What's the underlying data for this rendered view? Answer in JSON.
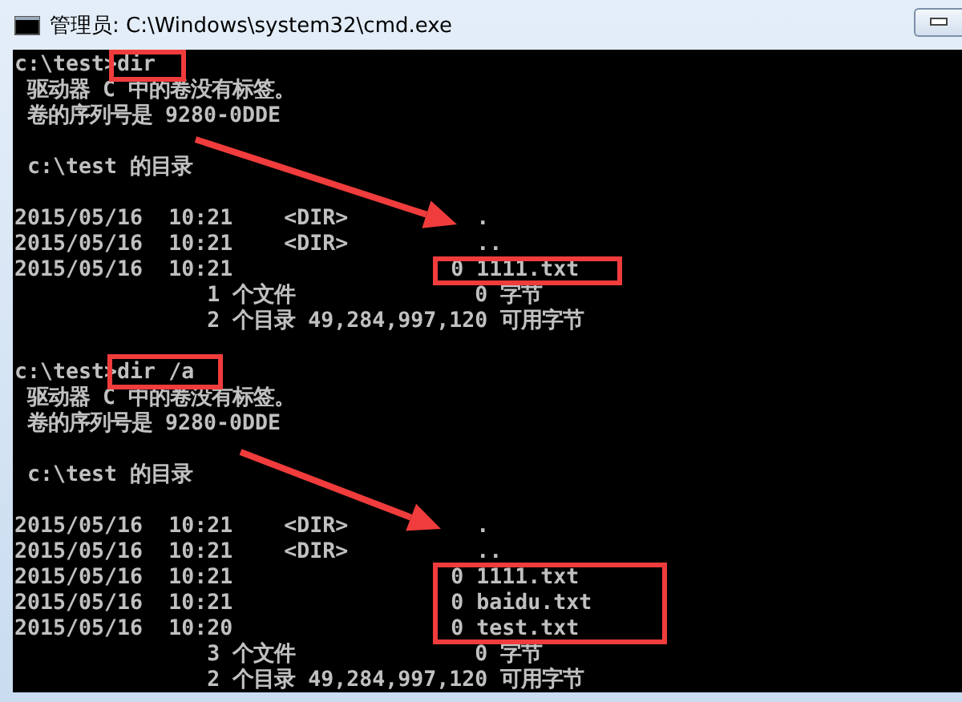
{
  "window": {
    "title": "管理员: C:\\Windows\\system32\\cmd.exe"
  },
  "console": {
    "blocks": [
      [
        {
          "kind": "command",
          "prompt": "c:\\test>",
          "command": "dir"
        },
        " 驱动器 C 中的卷没有标签。",
        " 卷的序列号是 9280-0DDE"
      ],
      [
        " c:\\test 的目录"
      ],
      [
        {
          "kind": "entry",
          "date": "2015/05/16",
          "time": "10:21",
          "tag": "<DIR>",
          "name": "."
        },
        {
          "kind": "entry",
          "date": "2015/05/16",
          "time": "10:21",
          "tag": "<DIR>",
          "name": ".."
        },
        {
          "kind": "entry",
          "date": "2015/05/16",
          "time": "10:21",
          "size": "0",
          "name": "1111.txt"
        },
        "               1 个文件              0 字节",
        "               2 个目录 49,284,997,120 可用字节"
      ],
      [
        {
          "kind": "command",
          "prompt": "c:\\test>",
          "command": "dir /a"
        },
        " 驱动器 C 中的卷没有标签。",
        " 卷的序列号是 9280-0DDE"
      ],
      [
        " c:\\test 的目录"
      ],
      [
        {
          "kind": "entry",
          "date": "2015/05/16",
          "time": "10:21",
          "tag": "<DIR>",
          "name": "."
        },
        {
          "kind": "entry",
          "date": "2015/05/16",
          "time": "10:21",
          "tag": "<DIR>",
          "name": ".."
        },
        {
          "kind": "entry",
          "date": "2015/05/16",
          "time": "10:21",
          "size": "0",
          "name": "1111.txt"
        },
        {
          "kind": "entry",
          "date": "2015/05/16",
          "time": "10:21",
          "size": "0",
          "name": "baidu.txt"
        },
        {
          "kind": "entry",
          "date": "2015/05/16",
          "time": "10:20",
          "size": "0",
          "name": "test.txt"
        },
        "               3 个文件              0 字节",
        "               2 个目录 49,284,997,120 可用字节"
      ]
    ]
  },
  "annotations": [
    {
      "kind": "box"
    },
    {
      "kind": "arrow"
    },
    {
      "kind": "box"
    },
    {
      "kind": "box"
    },
    {
      "kind": "arrow"
    },
    {
      "kind": "box"
    }
  ]
}
